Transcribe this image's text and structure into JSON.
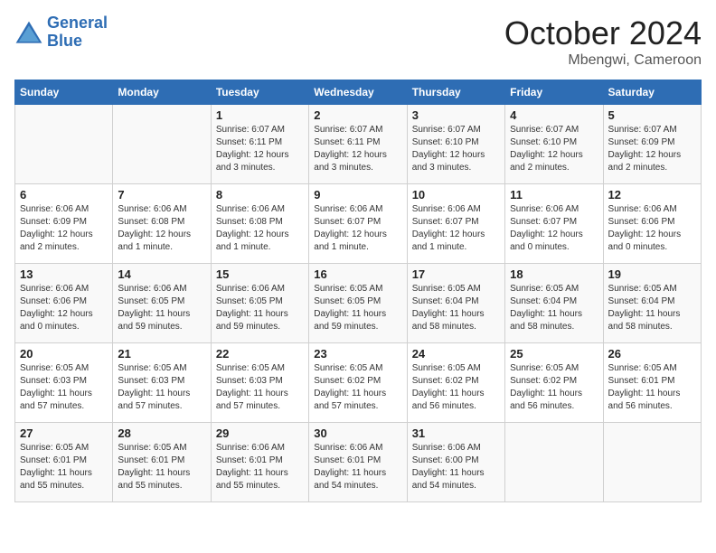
{
  "logo": {
    "line1": "General",
    "line2": "Blue"
  },
  "title": "October 2024",
  "subtitle": "Mbengwi, Cameroon",
  "weekdays": [
    "Sunday",
    "Monday",
    "Tuesday",
    "Wednesday",
    "Thursday",
    "Friday",
    "Saturday"
  ],
  "weeks": [
    [
      {
        "day": "",
        "info": ""
      },
      {
        "day": "",
        "info": ""
      },
      {
        "day": "1",
        "info": "Sunrise: 6:07 AM\nSunset: 6:11 PM\nDaylight: 12 hours and 3 minutes."
      },
      {
        "day": "2",
        "info": "Sunrise: 6:07 AM\nSunset: 6:11 PM\nDaylight: 12 hours and 3 minutes."
      },
      {
        "day": "3",
        "info": "Sunrise: 6:07 AM\nSunset: 6:10 PM\nDaylight: 12 hours and 3 minutes."
      },
      {
        "day": "4",
        "info": "Sunrise: 6:07 AM\nSunset: 6:10 PM\nDaylight: 12 hours and 2 minutes."
      },
      {
        "day": "5",
        "info": "Sunrise: 6:07 AM\nSunset: 6:09 PM\nDaylight: 12 hours and 2 minutes."
      }
    ],
    [
      {
        "day": "6",
        "info": "Sunrise: 6:06 AM\nSunset: 6:09 PM\nDaylight: 12 hours and 2 minutes."
      },
      {
        "day": "7",
        "info": "Sunrise: 6:06 AM\nSunset: 6:08 PM\nDaylight: 12 hours and 1 minute."
      },
      {
        "day": "8",
        "info": "Sunrise: 6:06 AM\nSunset: 6:08 PM\nDaylight: 12 hours and 1 minute."
      },
      {
        "day": "9",
        "info": "Sunrise: 6:06 AM\nSunset: 6:07 PM\nDaylight: 12 hours and 1 minute."
      },
      {
        "day": "10",
        "info": "Sunrise: 6:06 AM\nSunset: 6:07 PM\nDaylight: 12 hours and 1 minute."
      },
      {
        "day": "11",
        "info": "Sunrise: 6:06 AM\nSunset: 6:07 PM\nDaylight: 12 hours and 0 minutes."
      },
      {
        "day": "12",
        "info": "Sunrise: 6:06 AM\nSunset: 6:06 PM\nDaylight: 12 hours and 0 minutes."
      }
    ],
    [
      {
        "day": "13",
        "info": "Sunrise: 6:06 AM\nSunset: 6:06 PM\nDaylight: 12 hours and 0 minutes."
      },
      {
        "day": "14",
        "info": "Sunrise: 6:06 AM\nSunset: 6:05 PM\nDaylight: 11 hours and 59 minutes."
      },
      {
        "day": "15",
        "info": "Sunrise: 6:06 AM\nSunset: 6:05 PM\nDaylight: 11 hours and 59 minutes."
      },
      {
        "day": "16",
        "info": "Sunrise: 6:05 AM\nSunset: 6:05 PM\nDaylight: 11 hours and 59 minutes."
      },
      {
        "day": "17",
        "info": "Sunrise: 6:05 AM\nSunset: 6:04 PM\nDaylight: 11 hours and 58 minutes."
      },
      {
        "day": "18",
        "info": "Sunrise: 6:05 AM\nSunset: 6:04 PM\nDaylight: 11 hours and 58 minutes."
      },
      {
        "day": "19",
        "info": "Sunrise: 6:05 AM\nSunset: 6:04 PM\nDaylight: 11 hours and 58 minutes."
      }
    ],
    [
      {
        "day": "20",
        "info": "Sunrise: 6:05 AM\nSunset: 6:03 PM\nDaylight: 11 hours and 57 minutes."
      },
      {
        "day": "21",
        "info": "Sunrise: 6:05 AM\nSunset: 6:03 PM\nDaylight: 11 hours and 57 minutes."
      },
      {
        "day": "22",
        "info": "Sunrise: 6:05 AM\nSunset: 6:03 PM\nDaylight: 11 hours and 57 minutes."
      },
      {
        "day": "23",
        "info": "Sunrise: 6:05 AM\nSunset: 6:02 PM\nDaylight: 11 hours and 57 minutes."
      },
      {
        "day": "24",
        "info": "Sunrise: 6:05 AM\nSunset: 6:02 PM\nDaylight: 11 hours and 56 minutes."
      },
      {
        "day": "25",
        "info": "Sunrise: 6:05 AM\nSunset: 6:02 PM\nDaylight: 11 hours and 56 minutes."
      },
      {
        "day": "26",
        "info": "Sunrise: 6:05 AM\nSunset: 6:01 PM\nDaylight: 11 hours and 56 minutes."
      }
    ],
    [
      {
        "day": "27",
        "info": "Sunrise: 6:05 AM\nSunset: 6:01 PM\nDaylight: 11 hours and 55 minutes."
      },
      {
        "day": "28",
        "info": "Sunrise: 6:05 AM\nSunset: 6:01 PM\nDaylight: 11 hours and 55 minutes."
      },
      {
        "day": "29",
        "info": "Sunrise: 6:06 AM\nSunset: 6:01 PM\nDaylight: 11 hours and 55 minutes."
      },
      {
        "day": "30",
        "info": "Sunrise: 6:06 AM\nSunset: 6:01 PM\nDaylight: 11 hours and 54 minutes."
      },
      {
        "day": "31",
        "info": "Sunrise: 6:06 AM\nSunset: 6:00 PM\nDaylight: 11 hours and 54 minutes."
      },
      {
        "day": "",
        "info": ""
      },
      {
        "day": "",
        "info": ""
      }
    ]
  ]
}
